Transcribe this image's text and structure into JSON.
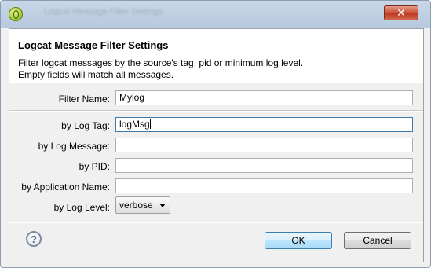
{
  "dialog": {
    "window_title": "Logcat Message Filter Settings",
    "close_symbol": "✕",
    "header": {
      "title": "Logcat Message Filter Settings",
      "description_line1": "Filter logcat messages by the source's tag, pid or minimum log level.",
      "description_line2": "Empty fields will match all messages."
    },
    "form": {
      "filter_name": {
        "label": "Filter Name:",
        "value": "Mylog"
      },
      "log_tag": {
        "label": "by Log Tag:",
        "value": "logMsg"
      },
      "log_message": {
        "label": "by Log Message:",
        "value": ""
      },
      "pid": {
        "label": "by PID:",
        "value": ""
      },
      "application_name": {
        "label": "by Application Name:",
        "value": ""
      },
      "log_level": {
        "label": "by Log Level:",
        "value": "verbose"
      }
    },
    "buttons": {
      "help_symbol": "?",
      "ok_label": "OK",
      "cancel_label": "Cancel"
    }
  }
}
